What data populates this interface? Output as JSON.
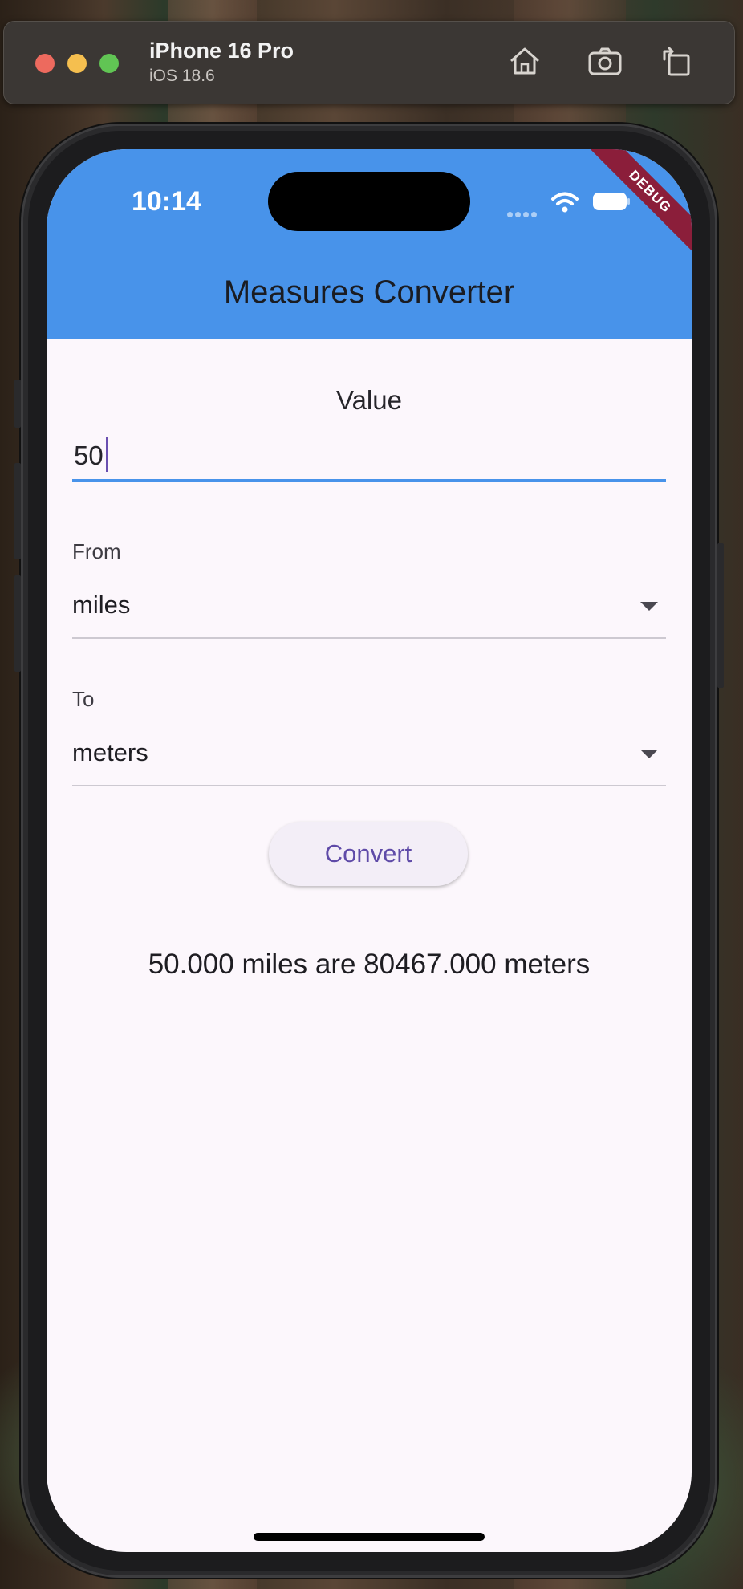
{
  "simulator": {
    "device_name": "iPhone 16 Pro",
    "os_version": "iOS 18.6",
    "toolbar_icons": [
      "home-icon",
      "screenshot-camera-icon",
      "rotate-icon"
    ]
  },
  "status_bar": {
    "time": "10:14",
    "icons": [
      "cellular-signal-icon",
      "wifi-icon",
      "battery-icon"
    ]
  },
  "debug_banner": "DEBUG",
  "app_bar": {
    "title": "Measures Converter",
    "color": "#4893ea"
  },
  "form": {
    "value_label": "Value",
    "value_input": "50",
    "from_label": "From",
    "from_value": "miles",
    "to_label": "To",
    "to_value": "meters",
    "convert_label": "Convert"
  },
  "result": {
    "text": "50.000 miles are 80467.000 meters"
  },
  "colors": {
    "accent": "#4893ea",
    "button_text": "#5f4ba8",
    "debug_banner": "#8b1e3a",
    "screen_background": "#fcf7fc"
  }
}
